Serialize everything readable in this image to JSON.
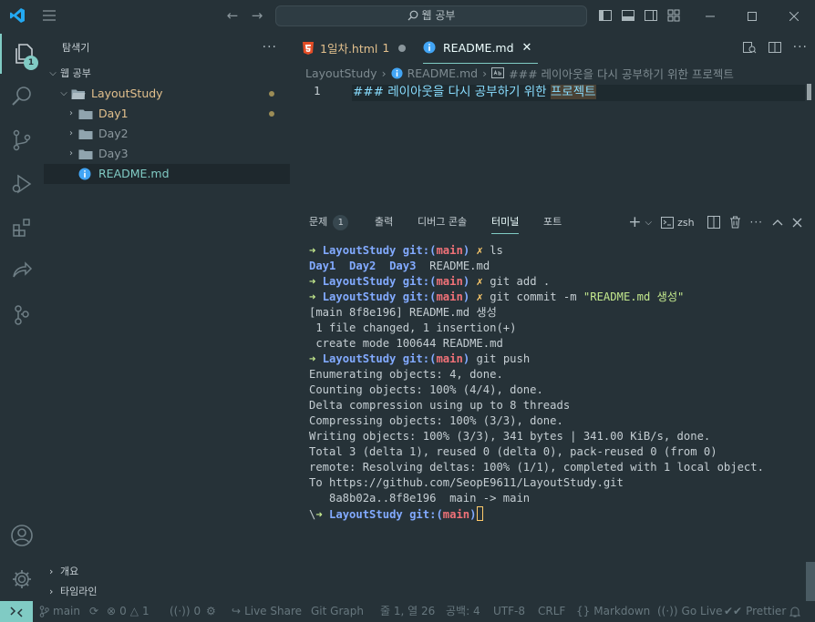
{
  "titlebar": {
    "search_text": "웹 공부"
  },
  "activitybar": {
    "explorer_badge": "1"
  },
  "sidebar": {
    "title": "탐색기",
    "more": "···",
    "workspace": "웹 공부",
    "tree": [
      {
        "label": "LayoutStudy",
        "color": "#e2c08d"
      },
      {
        "label": "Day1",
        "color": "#e2c08d"
      },
      {
        "label": "Day2",
        "color": "#8c989e"
      },
      {
        "label": "Day3",
        "color": "#8c989e"
      },
      {
        "label": "README.md",
        "color": "#80cbc4"
      }
    ],
    "outline": "개요",
    "timeline": "타임라인"
  },
  "tabs": [
    {
      "label": "1일차.html",
      "count": "1",
      "color": "#e2c08d"
    },
    {
      "label": "README.md",
      "color": "#eeffff"
    }
  ],
  "breadcrumb": {
    "folder": "LayoutStudy",
    "file": "README.md",
    "symbol": "### 레이아웃을 다시 공부하기 위한 프로젝트"
  },
  "editor": {
    "line_number": "1",
    "line_main": "### 레이아웃을 다시 공부하기 위한 ",
    "line_highlight": "프로젝트"
  },
  "panel": {
    "tabs": [
      "문제",
      "출력",
      "디버그 콘솔",
      "터미널",
      "포트"
    ],
    "problems_count": "1",
    "active_tab": "터미널",
    "shell": "zsh"
  },
  "terminal": {
    "arrow": "➜",
    "dir": "LayoutStudy",
    "git_label": "git:",
    "branch": "main",
    "x": "✗",
    "lines": [
      "ls",
      "Day1  Day2  Day3  README.md",
      "git add .",
      "git commit -m ",
      "\"README.md 생성\"",
      "[main 8f8e196] README.md 생성",
      " 1 file changed, 1 insertion(+)",
      " create mode 100644 README.md",
      "git push",
      "Enumerating objects: 4, done.",
      "Counting objects: 100% (4/4), done.",
      "Delta compression using up to 8 threads",
      "Compressing objects: 100% (3/3), done.",
      "Writing objects: 100% (3/3), 341 bytes | 341.00 KiB/s, done.",
      "Total 3 (delta 1), reused 0 (delta 0), pack-reused 0 (from 0)",
      "remote: Resolving deltas: 100% (1/1), completed with 1 local object.",
      "To https://github.com/SeopE9611/LayoutStudy.git",
      "   8a8b02a..8f8e196  main -> main",
      "\\"
    ],
    "dir_items": [
      "Day1",
      "Day2",
      "Day3"
    ],
    "plain_item": "README.md"
  },
  "statusbar": {
    "branch": "main",
    "errors": "0",
    "warnings": "1",
    "ports": "0",
    "live_share": "Live Share",
    "git_graph": "Git Graph",
    "position": "줄 1, 열 26",
    "spaces": "공백: 4",
    "encoding": "UTF-8",
    "eol": "CRLF",
    "language": "Markdown",
    "go_live": "Go Live",
    "prettier": "Prettier"
  }
}
